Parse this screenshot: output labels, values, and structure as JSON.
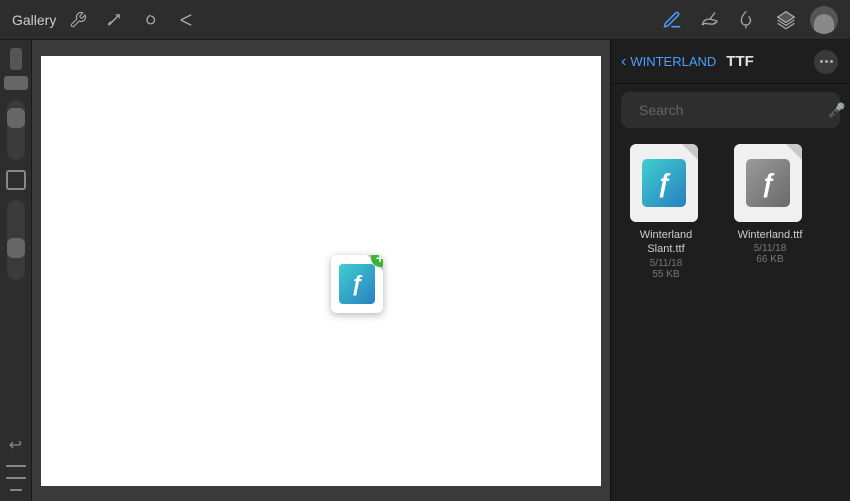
{
  "toolbar": {
    "gallery_label": "Gallery",
    "tools": [
      "wrench",
      "wand",
      "script",
      "arrow"
    ],
    "right_icons": [
      "pen",
      "brush1",
      "brush2",
      "layers",
      "avatar"
    ]
  },
  "sidebar": {
    "tools": [
      "color-swatch",
      "small-rect",
      "slider1",
      "square-outline",
      "slider2",
      "undo",
      "lines"
    ]
  },
  "right_panel": {
    "breadcrumb": "WINTERLAND",
    "title": "TTF",
    "search_placeholder": "Search",
    "files": [
      {
        "name": "Winterland Slant.ttf",
        "date": "5/11/18",
        "size": "55 KB",
        "style": "teal"
      },
      {
        "name": "Winterland.ttf",
        "date": "5/11/18",
        "size": "66 KB",
        "style": "gray"
      }
    ]
  },
  "dragged_file": {
    "add_badge": "+"
  }
}
